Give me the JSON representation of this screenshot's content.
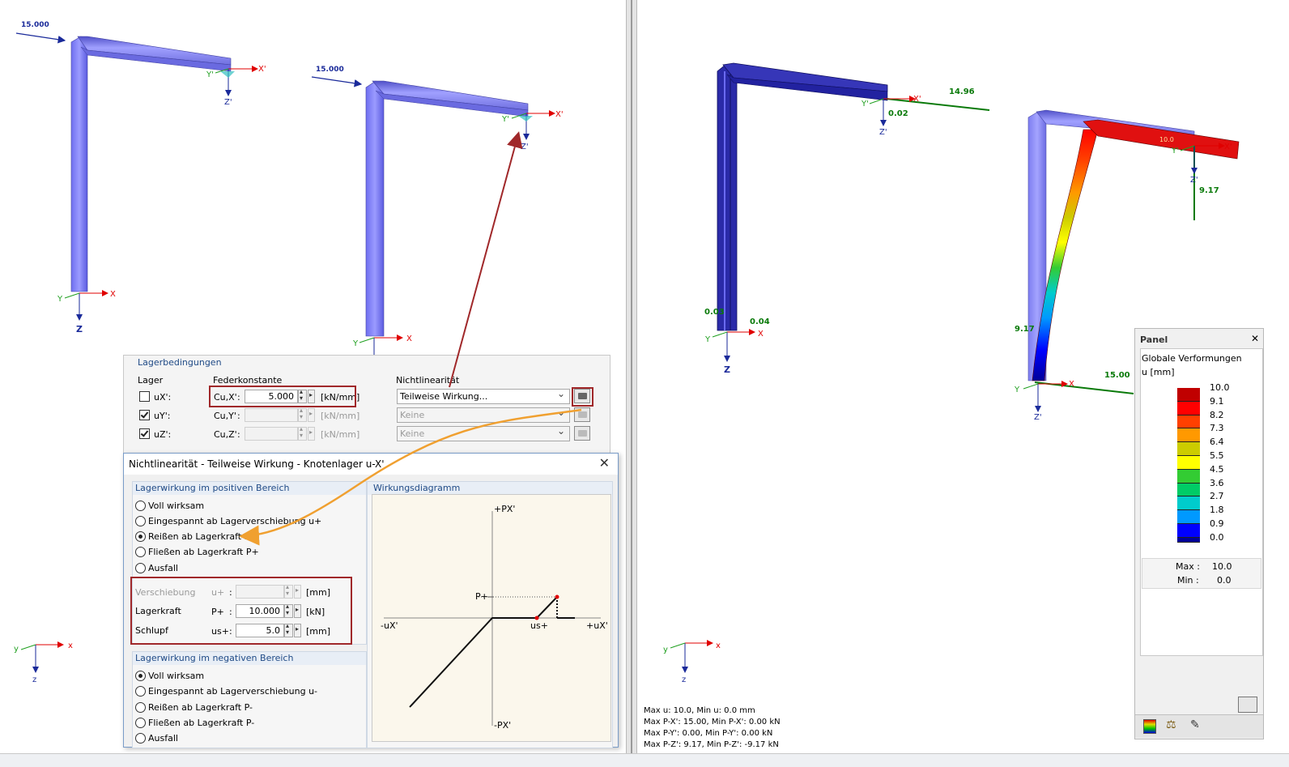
{
  "left_view": {
    "load_label_1": "15.000",
    "load_label_2": "15.000",
    "axes": {
      "x_prime": "X'",
      "y_prime": "Y'",
      "z_prime": "Z'",
      "x": "X",
      "y": "Y",
      "z": "Z"
    },
    "axes_lower": {
      "x": "x",
      "y": "y",
      "z": "z"
    }
  },
  "support_conditions": {
    "group_title": "Lagerbedingungen",
    "col_lager": "Lager",
    "col_federkonstante": "Federkonstante",
    "col_nichtlinearitaet": "Nichtlinearität",
    "rows": [
      {
        "name": "uX':",
        "checked": false,
        "const_label": "Cu,X'",
        "value": "5.000",
        "unit": "[kN/mm]",
        "nonlin": "Teilweise Wirkung...",
        "enabled": true
      },
      {
        "name": "uY':",
        "checked": true,
        "const_label": "Cu,Y'",
        "value": "",
        "unit": "[kN/mm]",
        "nonlin": "Keine",
        "enabled": false
      },
      {
        "name": "uZ':",
        "checked": true,
        "const_label": "Cu,Z'",
        "value": "",
        "unit": "[kN/mm]",
        "nonlin": "Keine",
        "enabled": false
      }
    ]
  },
  "dialog": {
    "title": "Nichtlinearität - Teilweise Wirkung - Knotenlager u-X'",
    "positive": {
      "title": "Lagerwirkung im positiven Bereich",
      "options": [
        "Voll wirksam",
        "Eingespannt ab Lagerverschiebung u+",
        "Reißen ab Lagerkraft P+",
        "Fließen ab Lagerkraft P+",
        "Ausfall"
      ],
      "selected": 2,
      "fields": [
        {
          "label": "Verschiebung",
          "sym": "u+",
          "value": "",
          "unit": "[mm]",
          "enabled": false
        },
        {
          "label": "Lagerkraft",
          "sym": "P+",
          "value": "10.000",
          "unit": "[kN]",
          "enabled": true
        },
        {
          "label": "Schlupf",
          "sym": "us+",
          "value": "5.0",
          "unit": "[mm]",
          "enabled": true
        }
      ]
    },
    "negative": {
      "title": "Lagerwirkung im negativen Bereich",
      "options": [
        "Voll wirksam",
        "Eingespannt ab Lagerverschiebung u-",
        "Reißen ab Lagerkraft P-",
        "Fließen ab Lagerkraft P-",
        "Ausfall"
      ],
      "selected": 0
    },
    "diagram": {
      "title": "Wirkungsdiagramm",
      "p_plus_axis": "+PX'",
      "p_minus_axis": "-PX'",
      "u_minus_axis": "-uX'",
      "u_plus_axis": "+uX'",
      "p_plus": "P+",
      "us_plus": "us+"
    }
  },
  "right_view": {
    "values": {
      "v1": "14.96",
      "v2": "0.02",
      "v3": "0.03",
      "v4": "0.04",
      "v5": "9.17",
      "v6": "9.17",
      "v7": "15.00",
      "v8": "10.0"
    },
    "axes": {
      "x_prime": "X'",
      "y_prime": "Y'",
      "z_prime": "Z'",
      "x": "X",
      "y": "Y",
      "z": "Z",
      "x_lower": "x",
      "y_lower": "y",
      "z_lower": "z"
    }
  },
  "status_lines": [
    "Max u: 10.0, Min u: 0.0 mm",
    "Max P-X': 15.00, Min P-X': 0.00 kN",
    "Max P-Y': 0.00, Min P-Y': 0.00 kN",
    "Max P-Z': 9.17, Min P-Z': -9.17 kN"
  ],
  "panel": {
    "title": "Panel",
    "subtitle": "Globale Verformungen",
    "unit": "u [mm]",
    "scale": [
      {
        "value": "10.0",
        "color": "#c00000"
      },
      {
        "value": "9.1",
        "color": "#ff0000"
      },
      {
        "value": "8.2",
        "color": "#ff4000"
      },
      {
        "value": "7.3",
        "color": "#ff9900"
      },
      {
        "value": "6.4",
        "color": "#cccc00"
      },
      {
        "value": "5.5",
        "color": "#ffff00"
      },
      {
        "value": "4.5",
        "color": "#33cc33"
      },
      {
        "value": "3.6",
        "color": "#00cc66"
      },
      {
        "value": "2.7",
        "color": "#00cccc"
      },
      {
        "value": "1.8",
        "color": "#0099ff"
      },
      {
        "value": "0.9",
        "color": "#0000ff"
      },
      {
        "value": "0.0",
        "color": "#000099"
      }
    ],
    "max_label": "Max :",
    "max_value": "10.0",
    "min_label": "Min :",
    "min_value": "0.0"
  }
}
